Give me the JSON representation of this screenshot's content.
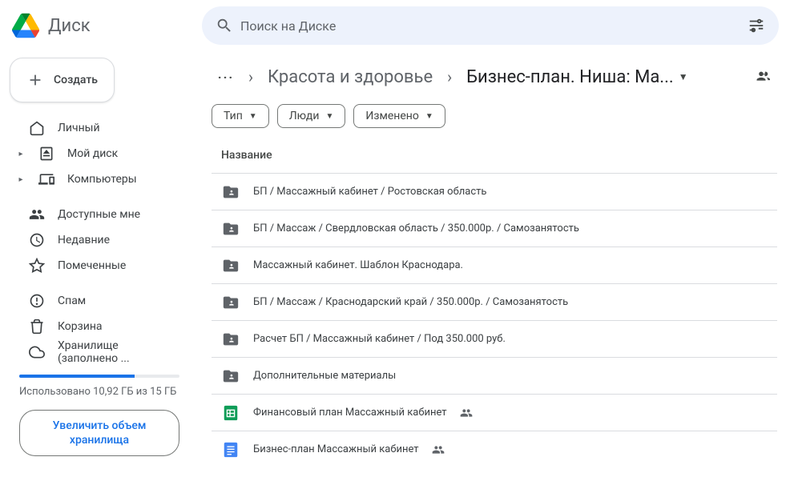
{
  "header": {
    "product_name": "Диск",
    "search_placeholder": "Поиск на Диске"
  },
  "sidebar": {
    "create_label": "Создать",
    "items": [
      {
        "label": "Личный",
        "icon": "home",
        "expandable": false
      },
      {
        "label": "Мой диск",
        "icon": "drive",
        "expandable": true
      },
      {
        "label": "Компьютеры",
        "icon": "devices",
        "expandable": true
      }
    ],
    "items2": [
      {
        "label": "Доступные мне",
        "icon": "shared"
      },
      {
        "label": "Недавние",
        "icon": "recent"
      },
      {
        "label": "Помеченные",
        "icon": "star"
      }
    ],
    "items3": [
      {
        "label": "Спам",
        "icon": "spam"
      },
      {
        "label": "Корзина",
        "icon": "trash"
      },
      {
        "label": "Хранилище (заполнено ...",
        "icon": "cloud"
      }
    ],
    "storage_text": "Использовано 10,92 ГБ из 15 ГБ",
    "upgrade_label": "Увеличить объем хранилища"
  },
  "breadcrumb": {
    "parent": "Красота и здоровье",
    "current": "Бизнес-план. Ниша: Ма..."
  },
  "filters": {
    "type": "Тип",
    "people": "Люди",
    "modified": "Изменено"
  },
  "column_header": "Название",
  "files": [
    {
      "type": "folder-shared",
      "name": "БП / Массажный кабинет / Ростовская область",
      "shared": false
    },
    {
      "type": "folder-shared",
      "name": "БП / Массаж / Свердловская область / 350.000р. / Самозанятость",
      "shared": false
    },
    {
      "type": "folder-shared",
      "name": "Массажный кабинет. Шаблон Краснодара.",
      "shared": false
    },
    {
      "type": "folder-shared",
      "name": "БП / Массаж / Краснодарский край / 350.000р. / Самозанятость",
      "shared": false
    },
    {
      "type": "folder-shared",
      "name": "Расчет БП / Массажный кабинет / Под 350.000 руб.",
      "shared": false
    },
    {
      "type": "folder-shared",
      "name": "Дополнительные материалы",
      "shared": false
    },
    {
      "type": "sheets",
      "name": "Финансовый план Массажный кабинет",
      "shared": true
    },
    {
      "type": "docs",
      "name": "Бизнес-план Массажный кабинет",
      "shared": true
    }
  ]
}
